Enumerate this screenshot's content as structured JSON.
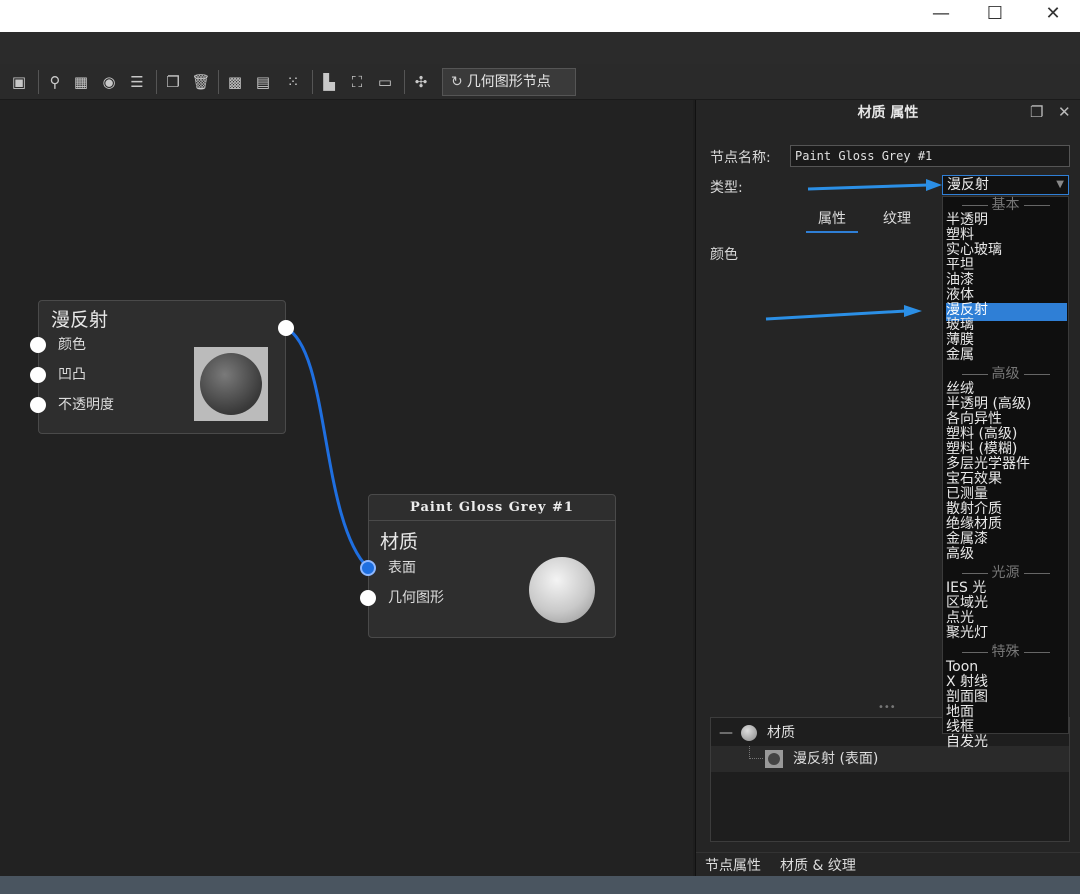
{
  "window": {
    "minimize_glyph": "—",
    "maximize_glyph": "☐",
    "close_glyph": "✕"
  },
  "toolbar": {
    "geometry_node_label": "几何图形节点",
    "icons": [
      "save-icon",
      "search-icon",
      "layout-icon",
      "play-icon",
      "sliders-icon",
      "copy-icon",
      "delete-icon",
      "add-node-icon",
      "group-icon",
      "ungroup-icon",
      "align-icon",
      "fit-icon",
      "zoom-100-icon",
      "split-icon",
      "refresh-icon"
    ]
  },
  "graph": {
    "diffuse_node": {
      "title": "漫反射",
      "ports": [
        "颜色",
        "凹凸",
        "不透明度"
      ]
    },
    "material_node": {
      "header": "Paint Gloss Grey #1",
      "title": "材质",
      "ports": [
        "表面",
        "几何图形"
      ]
    },
    "link_color": "#1f6fe0"
  },
  "panel": {
    "title": "材质 属性",
    "node_name_label": "节点名称:",
    "node_name_value": "Paint Gloss Grey #1",
    "type_label": "类型:",
    "type_value": "漫反射",
    "tabs": [
      "属性",
      "纹理"
    ],
    "color_label": "颜色",
    "tree": {
      "collapse_glyph": "—",
      "root": "材质",
      "child": "漫反射 (表面)"
    },
    "bottom_tabs": [
      "节点属性",
      "材质 & 纹理"
    ],
    "resize_handle": "•••"
  },
  "dropdown": {
    "groups": [
      {
        "label": "基本",
        "items": [
          "半透明",
          "塑料",
          "实心玻璃",
          "平坦",
          "油漆",
          "液体",
          "漫反射",
          "玻璃",
          "薄膜",
          "金属"
        ]
      },
      {
        "label": "高级",
        "items": [
          "丝绒",
          "半透明 (高级)",
          "各向异性",
          "塑料 (高级)",
          "塑料 (模糊)",
          "多层光学器件",
          "宝石效果",
          "已测量",
          "散射介质",
          "绝缘材质",
          "金属漆",
          "高级"
        ]
      },
      {
        "label": "光源",
        "items": [
          "IES 光",
          "区域光",
          "点光",
          "聚光灯"
        ]
      },
      {
        "label": "特殊",
        "items": [
          "Toon",
          "X 射线",
          "剖面图",
          "地面",
          "线框",
          "自发光"
        ]
      }
    ],
    "selected": "漫反射"
  },
  "colors": {
    "accent": "#2f7fd6",
    "arrow": "#2b8fe6"
  }
}
